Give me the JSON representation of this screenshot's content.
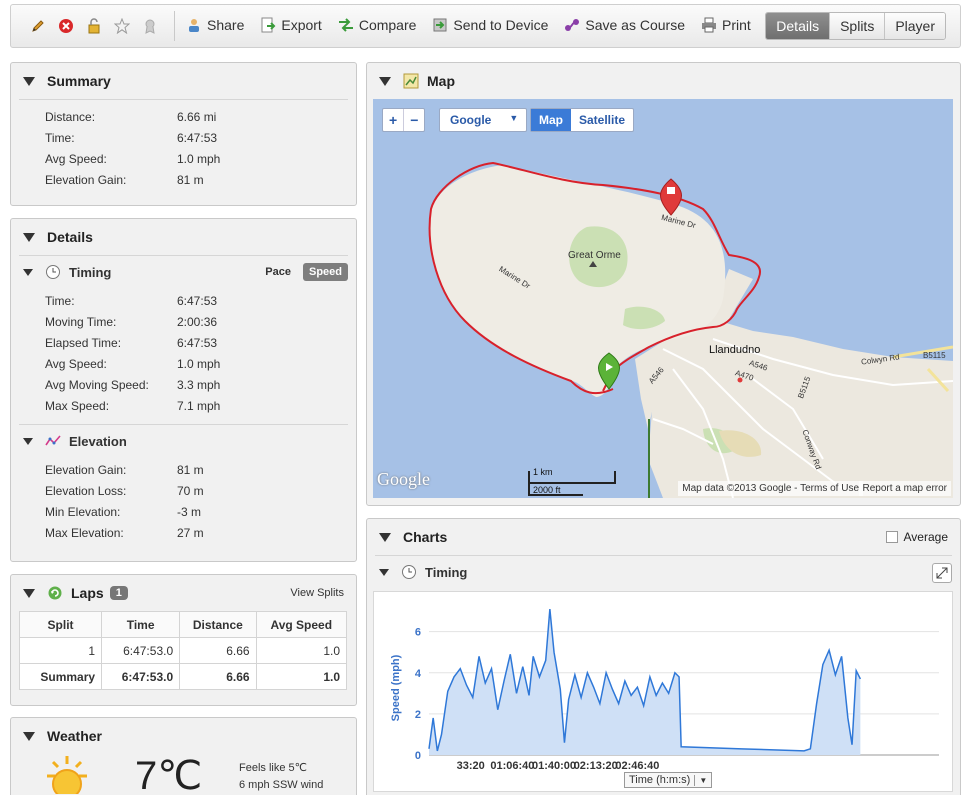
{
  "toolbar": {
    "actions": [
      "Share",
      "Export",
      "Compare",
      "Send to Device",
      "Save as Course",
      "Print"
    ],
    "views": [
      "Details",
      "Splits",
      "Player"
    ],
    "active_view": "Details"
  },
  "summary": {
    "title": "Summary",
    "rows": [
      {
        "k": "Distance:",
        "v": "6.66 mi"
      },
      {
        "k": "Time:",
        "v": "6:47:53"
      },
      {
        "k": "Avg Speed:",
        "v": "1.0 mph"
      },
      {
        "k": "Elevation Gain:",
        "v": "81 m"
      }
    ]
  },
  "details": {
    "title": "Details",
    "timing": {
      "title": "Timing",
      "pace": "Pace",
      "speed": "Speed",
      "rows": [
        {
          "k": "Time:",
          "v": "6:47:53"
        },
        {
          "k": "Moving Time:",
          "v": "2:00:36"
        },
        {
          "k": "Elapsed Time:",
          "v": "6:47:53"
        },
        {
          "k": "Avg Speed:",
          "v": "1.0 mph"
        },
        {
          "k": "Avg Moving Speed:",
          "v": "3.3 mph"
        },
        {
          "k": "Max Speed:",
          "v": "7.1 mph"
        }
      ]
    },
    "elevation": {
      "title": "Elevation",
      "rows": [
        {
          "k": "Elevation Gain:",
          "v": "81 m"
        },
        {
          "k": "Elevation Loss:",
          "v": "70 m"
        },
        {
          "k": "Min Elevation:",
          "v": "-3 m"
        },
        {
          "k": "Max Elevation:",
          "v": "27 m"
        }
      ]
    }
  },
  "laps": {
    "title": "Laps",
    "count": "1",
    "view_splits": "View Splits",
    "headers": [
      "Split",
      "Time",
      "Distance",
      "Avg Speed"
    ],
    "rows": [
      [
        "1",
        "6:47:53.0",
        "6.66",
        "1.0"
      ]
    ],
    "summary": [
      "Summary",
      "6:47:53.0",
      "6.66",
      "1.0"
    ]
  },
  "weather": {
    "title": "Weather",
    "temp": "7℃",
    "feels": "Feels like 5℃",
    "wind": "6 mph SSW wind"
  },
  "map": {
    "title": "Map",
    "provider": "Google",
    "map_btn": "Map",
    "sat_btn": "Satellite",
    "labels": {
      "great_orme": "Great Orme",
      "llandudno": "Llandudno",
      "marine_dr_1": "Marine Dr",
      "marine_dr_2": "Marine Dr",
      "a546": "A546",
      "a546b": "A546",
      "a470": "A470",
      "b5115": "B5115",
      "b5115b": "B5115",
      "colwyn": "Colwyn Rd",
      "conway": "Conway Rd"
    },
    "scale_km": "1 km",
    "scale_ft": "2000 ft",
    "google_logo": "Google",
    "attribution": "Map data ©2013 Google - Terms of Use",
    "report": "Report a map error"
  },
  "charts": {
    "title": "Charts",
    "average": "Average",
    "timing_title": "Timing",
    "ylabel": "Speed (mph)",
    "xsel": "Time (h:m:s)"
  },
  "chart_data": {
    "type": "area",
    "title": "",
    "xlabel": "Time (h:m:s)",
    "ylabel": "Speed (mph)",
    "ylim": [
      0,
      7.2
    ],
    "xlim": [
      0,
      24473
    ],
    "yticks": [
      0,
      2,
      4,
      6
    ],
    "xticks": [
      "33:20",
      "01:06:40",
      "01:40:00",
      "02:13:20",
      "02:46:40"
    ],
    "grid": true,
    "series": [
      {
        "name": "Speed",
        "points": [
          [
            0,
            0.3
          ],
          [
            200,
            1.8
          ],
          [
            400,
            0.2
          ],
          [
            600,
            1.0
          ],
          [
            900,
            3.1
          ],
          [
            1200,
            3.8
          ],
          [
            1500,
            4.2
          ],
          [
            1800,
            3.4
          ],
          [
            2100,
            2.8
          ],
          [
            2400,
            4.8
          ],
          [
            2700,
            3.5
          ],
          [
            3000,
            4.2
          ],
          [
            3300,
            2.2
          ],
          [
            3600,
            3.6
          ],
          [
            3900,
            4.9
          ],
          [
            4200,
            3.0
          ],
          [
            4500,
            4.3
          ],
          [
            4800,
            2.9
          ],
          [
            5000,
            4.8
          ],
          [
            5300,
            3.8
          ],
          [
            5600,
            4.6
          ],
          [
            5800,
            7.1
          ],
          [
            6000,
            5.0
          ],
          [
            6300,
            3.2
          ],
          [
            6500,
            0.6
          ],
          [
            6700,
            2.7
          ],
          [
            7000,
            3.9
          ],
          [
            7300,
            2.8
          ],
          [
            7600,
            4.0
          ],
          [
            7900,
            3.3
          ],
          [
            8200,
            2.5
          ],
          [
            8500,
            4.0
          ],
          [
            8800,
            3.2
          ],
          [
            9100,
            2.5
          ],
          [
            9400,
            3.6
          ],
          [
            9700,
            2.9
          ],
          [
            10000,
            3.3
          ],
          [
            10300,
            2.4
          ],
          [
            10600,
            3.8
          ],
          [
            10900,
            2.9
          ],
          [
            11200,
            3.5
          ],
          [
            11500,
            3.0
          ],
          [
            11800,
            4.0
          ],
          [
            12000,
            3.8
          ],
          [
            12100,
            0.4
          ],
          [
            15000,
            0.3
          ],
          [
            18000,
            0.2
          ],
          [
            18300,
            0.3
          ],
          [
            18600,
            2.5
          ],
          [
            18900,
            4.4
          ],
          [
            19200,
            5.1
          ],
          [
            19500,
            3.9
          ],
          [
            19800,
            4.8
          ],
          [
            20100,
            1.8
          ],
          [
            20300,
            0.5
          ],
          [
            20500,
            4.1
          ],
          [
            20700,
            3.7
          ]
        ]
      }
    ]
  }
}
